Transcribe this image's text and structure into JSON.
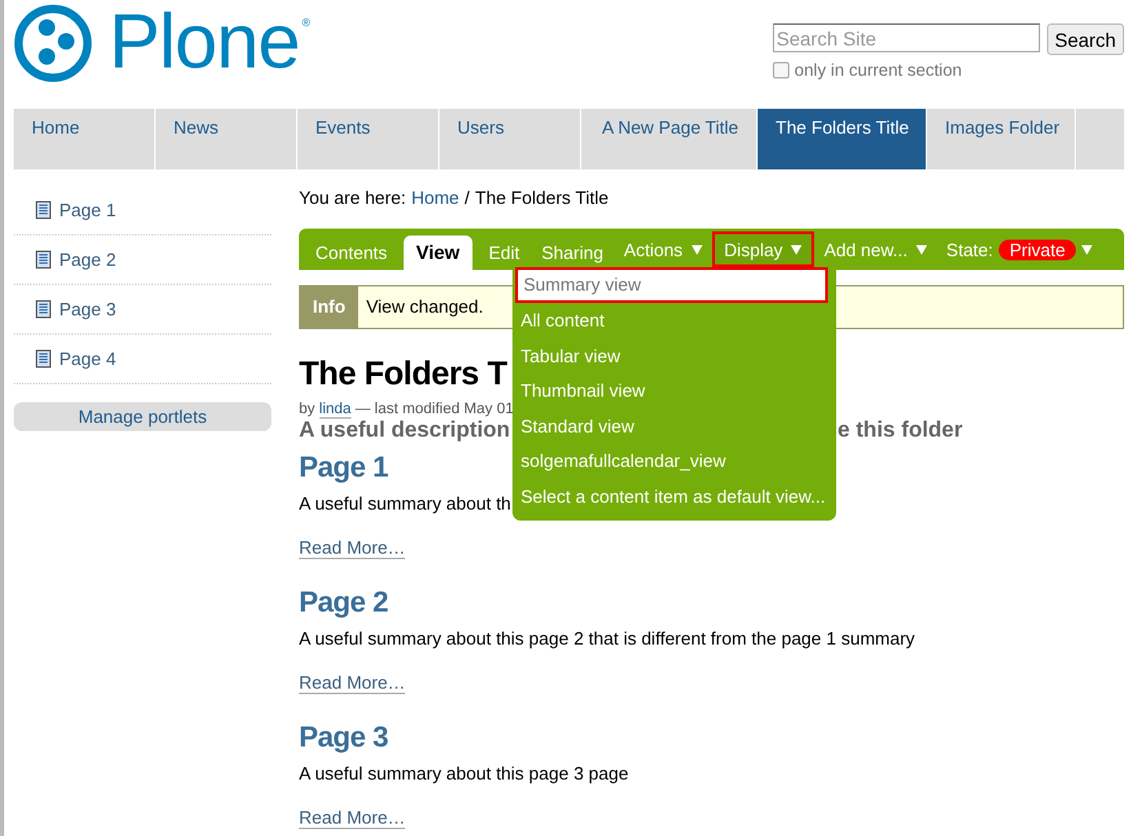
{
  "logo": {
    "text": "Plone",
    "mark": "®"
  },
  "search": {
    "placeholder": "Search Site",
    "button": "Search",
    "scope_label": "only in current section",
    "scope_checked": false
  },
  "nav": [
    {
      "label": "Home",
      "selected": false
    },
    {
      "label": "News",
      "selected": false
    },
    {
      "label": "Events",
      "selected": false
    },
    {
      "label": "Users",
      "selected": false
    },
    {
      "label": "A New Page Title",
      "selected": false
    },
    {
      "label": "The Folders Title",
      "selected": true
    },
    {
      "label": "Images Folder",
      "selected": false
    }
  ],
  "sidebar": {
    "items": [
      "Page 1",
      "Page 2",
      "Page 3",
      "Page 4"
    ],
    "manage_button": "Manage portlets"
  },
  "breadcrumb": {
    "prefix": "You are here:",
    "items": [
      "Home",
      "The Folders Title"
    ],
    "separator": "/"
  },
  "edit_bar": {
    "tabs": [
      {
        "label": "Contents",
        "kind": "tab",
        "selected": false
      },
      {
        "label": "View",
        "kind": "tab",
        "selected": true
      },
      {
        "label": "Edit",
        "kind": "tab",
        "selected": false
      },
      {
        "label": "Sharing",
        "kind": "tab",
        "selected": false
      },
      {
        "label": "Actions",
        "kind": "menu",
        "highlighted": false
      },
      {
        "label": "Display",
        "kind": "menu",
        "highlighted": true
      },
      {
        "label": "Add new...",
        "kind": "menu",
        "highlighted": false
      }
    ],
    "state": {
      "label": "State:",
      "value": "Private",
      "color": "#ff0000"
    }
  },
  "dropdown": {
    "items": [
      {
        "label": "Summary view",
        "selected": true
      },
      {
        "label": "All content",
        "selected": false
      },
      {
        "label": "Tabular view",
        "selected": false
      },
      {
        "label": "Thumbnail view",
        "selected": false
      },
      {
        "label": "Standard view",
        "selected": false
      },
      {
        "label": "solgemafullcalendar_view",
        "selected": false
      },
      {
        "label": "Select a content item as default view...",
        "selected": false
      }
    ]
  },
  "message": {
    "type": "Info",
    "text": "View changed."
  },
  "content": {
    "title": "The Folders T",
    "byline": {
      "prefix": "by",
      "author": "linda",
      "suffix": "— last modified May 01"
    },
    "description": {
      "left": "A useful description",
      "right": "e this folder"
    },
    "items": [
      {
        "title": "Page 1",
        "summary": "A useful summary about th",
        "link": "Read More…"
      },
      {
        "title": "Page 2",
        "summary": "A useful summary about this page 2 that is different from the page 1 summary",
        "link": "Read More…"
      },
      {
        "title": "Page 3",
        "summary": "A useful summary about this page 3 page",
        "link": "Read More…"
      }
    ]
  }
}
